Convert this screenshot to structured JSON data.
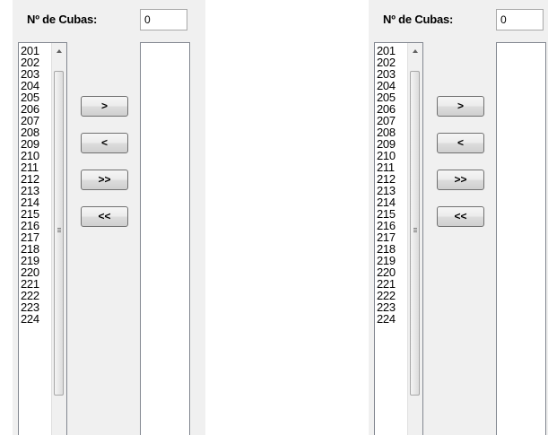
{
  "panels": [
    {
      "count_label": "Nº de Cubas:",
      "count_value": "0",
      "available_items": [
        "201",
        "202",
        "203",
        "204",
        "205",
        "206",
        "207",
        "208",
        "209",
        "210",
        "211",
        "212",
        "213",
        "214",
        "215",
        "216",
        "217",
        "218",
        "219",
        "220",
        "221",
        "222",
        "223",
        "224"
      ],
      "buttons": {
        "move_selected": ">",
        "remove_selected": "<",
        "move_all": ">>",
        "remove_all": "<<"
      }
    },
    {
      "count_label": "Nº de Cubas:",
      "count_value": "0",
      "available_items": [
        "201",
        "202",
        "203",
        "204",
        "205",
        "206",
        "207",
        "208",
        "209",
        "210",
        "211",
        "212",
        "213",
        "214",
        "215",
        "216",
        "217",
        "218",
        "219",
        "220",
        "221",
        "222",
        "223",
        "224"
      ],
      "buttons": {
        "move_selected": ">",
        "remove_selected": "<",
        "move_all": ">>",
        "remove_all": "<<"
      }
    }
  ],
  "icons": {
    "scroll_up": "triangle-up",
    "scroll_grip": "grip-lines"
  }
}
